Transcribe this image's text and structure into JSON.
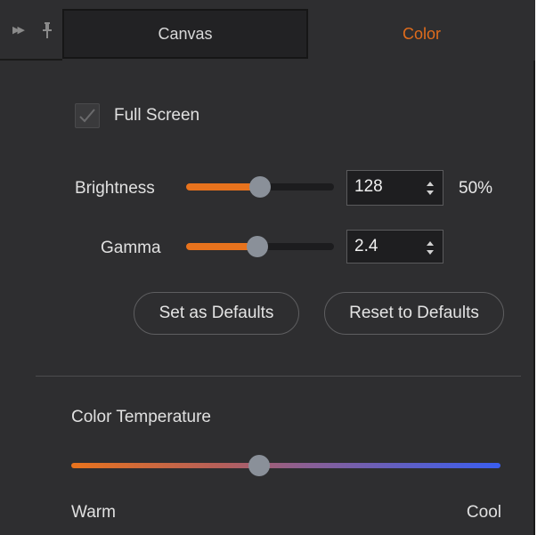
{
  "header": {
    "icons": [
      "expand-icon",
      "pin-icon"
    ],
    "tabs": [
      {
        "label": "Canvas",
        "active": false
      },
      {
        "label": "Color",
        "active": true
      }
    ],
    "active_color": "#e06c1c"
  },
  "full_screen": {
    "label": "Full Screen",
    "checked": true
  },
  "brightness": {
    "label": "Brightness",
    "value": "128",
    "percent": "50%",
    "fraction": 0.5
  },
  "gamma": {
    "label": "Gamma",
    "value": "2.4",
    "fraction": 0.48
  },
  "buttons": {
    "set_defaults": "Set as Defaults",
    "reset_defaults": "Reset to Defaults"
  },
  "color_temperature": {
    "label": "Color Temperature",
    "warm_label": "Warm",
    "cool_label": "Cool",
    "fraction": 0.437,
    "warm_color": "#e8731d",
    "cool_color": "#3a5ef0"
  },
  "accent": "#e8731d"
}
